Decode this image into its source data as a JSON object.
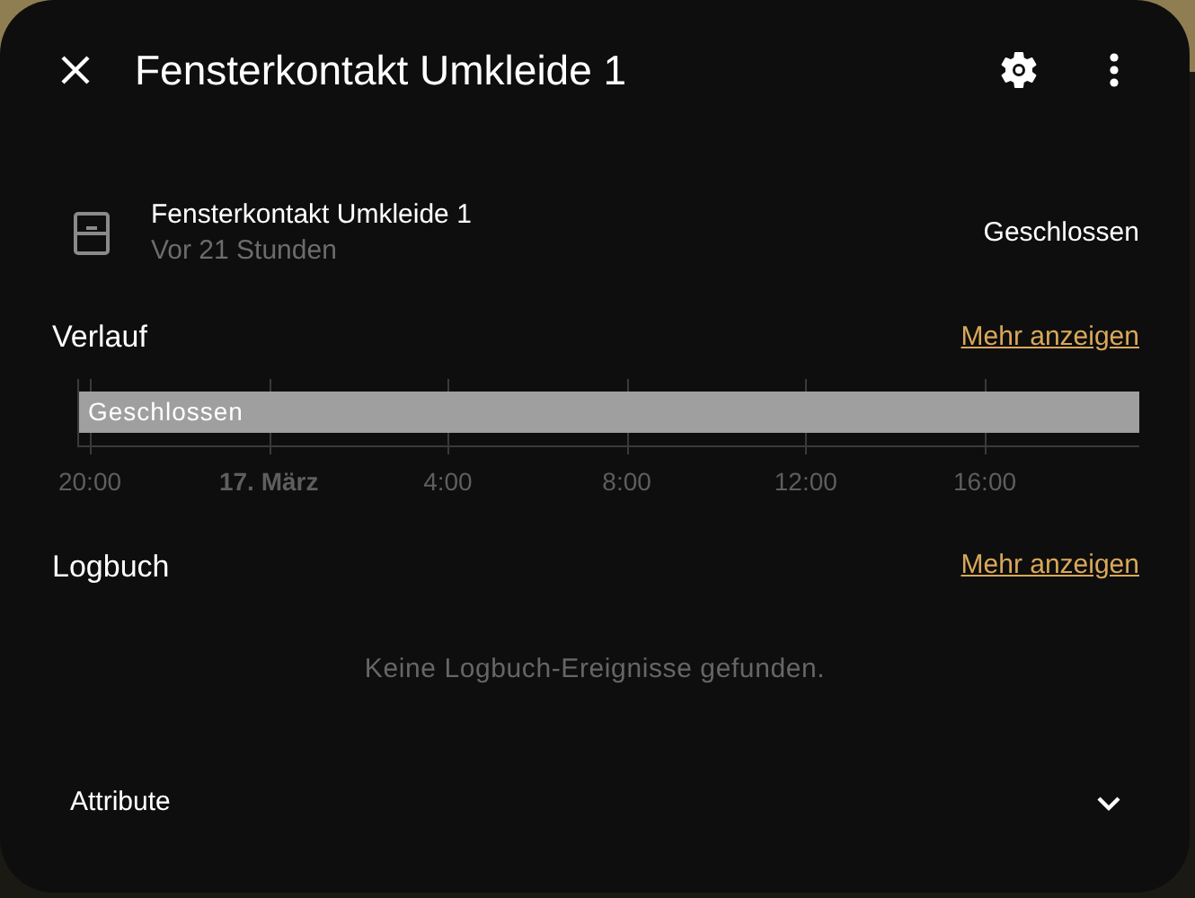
{
  "dialog": {
    "title": "Fensterkontakt Umkleide 1"
  },
  "entity": {
    "name": "Fensterkontakt Umkleide 1",
    "last_changed": "Vor 21 Stunden",
    "state": "Geschlossen"
  },
  "history": {
    "heading": "Verlauf",
    "more_link": "Mehr anzeigen",
    "timeline": {
      "bar_label": "Geschlossen",
      "ticks": [
        {
          "label": "20:00",
          "emphasized": false
        },
        {
          "label": "17. März",
          "emphasized": true
        },
        {
          "label": "4:00",
          "emphasized": false
        },
        {
          "label": "8:00",
          "emphasized": false
        },
        {
          "label": "12:00",
          "emphasized": false
        },
        {
          "label": "16:00",
          "emphasized": false
        }
      ]
    }
  },
  "logbook": {
    "heading": "Logbuch",
    "more_link": "Mehr anzeigen",
    "empty_message": "Keine Logbuch-Ereignisse gefunden."
  },
  "attributes": {
    "label": "Attribute",
    "expanded": false
  }
}
